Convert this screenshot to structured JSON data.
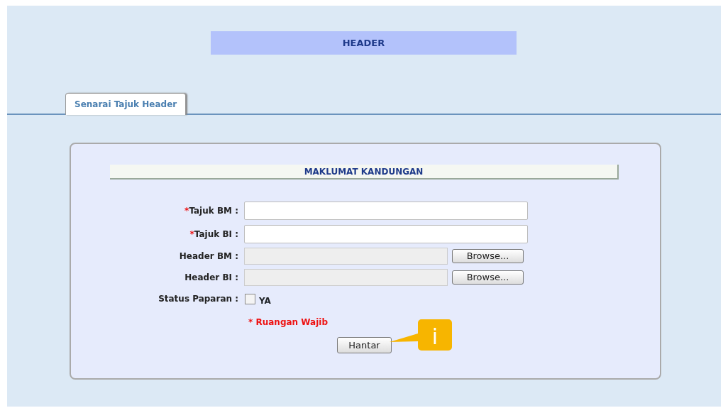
{
  "header": {
    "title": "HEADER"
  },
  "tabs": [
    {
      "label": "Senarai Tajuk Header",
      "selected": true
    }
  ],
  "form": {
    "section_title": "MAKLUMAT KANDUNGAN",
    "fields": [
      {
        "kind": "text",
        "required_mark": "*",
        "label": "Tajuk BM :"
      },
      {
        "kind": "text",
        "required_mark": "*",
        "label": "Tajuk BI :"
      },
      {
        "kind": "file",
        "label": "Header BM :",
        "button": "Browse..."
      },
      {
        "kind": "file",
        "label": "Header BI :",
        "button": "Browse..."
      },
      {
        "kind": "checkbox",
        "label": "Status Paparan :",
        "option": "YA",
        "checked": false
      }
    ],
    "note": "* Ruangan Wajib",
    "submit": "Hantar",
    "callout": "i"
  }
}
